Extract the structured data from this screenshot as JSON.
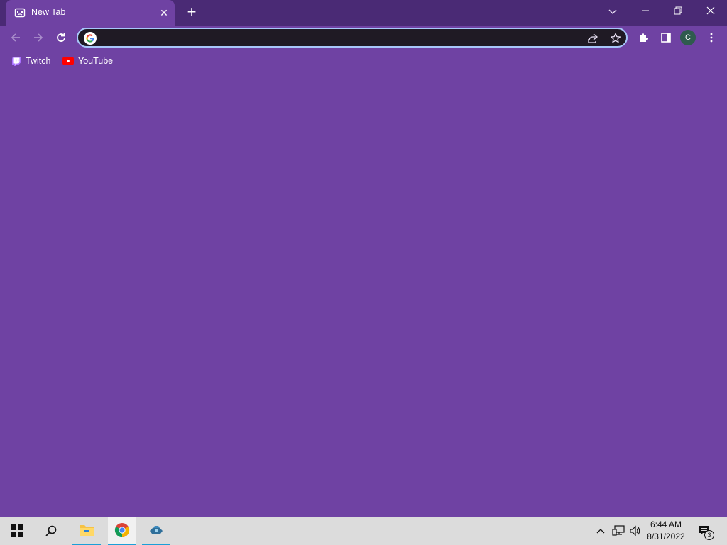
{
  "browser": {
    "tab": {
      "title": "New Tab"
    },
    "omnibox": {
      "value": "",
      "placeholder": ""
    },
    "profile_initial": "C"
  },
  "bookmarks": [
    {
      "label": "Twitch",
      "icon": "twitch-icon"
    },
    {
      "label": "YouTube",
      "icon": "youtube-icon"
    }
  ],
  "taskbar": {
    "apps": [
      "start-icon",
      "search-icon",
      "file-explorer-icon",
      "chrome-icon",
      "game-icon"
    ],
    "clock": {
      "time": "6:44 AM",
      "date": "8/31/2022"
    },
    "notification_count": "3"
  },
  "colors": {
    "theme": "#6f42a3",
    "titlebar": "#4a2a75",
    "omnibox_bg": "#1f1a24",
    "omnibox_focus": "#a8c7fa",
    "taskbar": "#dcdcdc"
  }
}
